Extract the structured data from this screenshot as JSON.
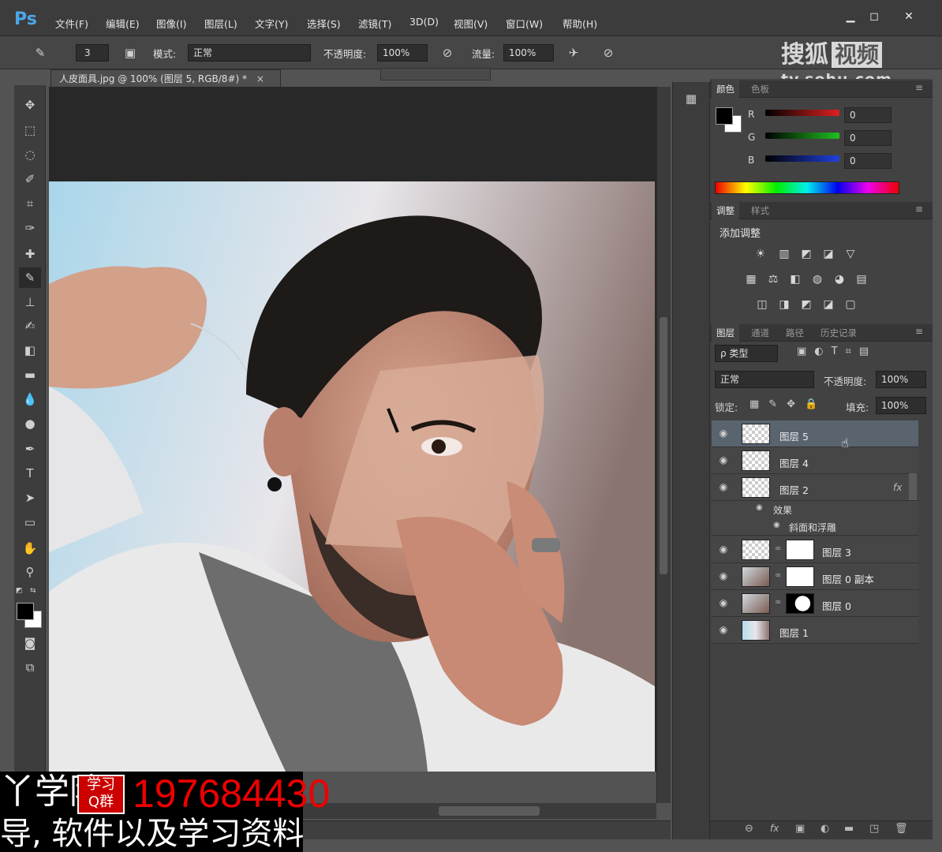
{
  "app": {
    "logo": "Ps"
  },
  "menu": [
    "文件(F)",
    "编辑(E)",
    "图像(I)",
    "图层(L)",
    "文字(Y)",
    "选择(S)",
    "滤镜(T)",
    "3D(D)",
    "视图(V)",
    "窗口(W)",
    "帮助(H)"
  ],
  "window_controls": [
    "▁",
    "◻",
    "✕"
  ],
  "options": {
    "brush_size": "3",
    "mode_label": "模式:",
    "mode_value": "正常",
    "opacity_label": "不透明度:",
    "opacity_value": "100%",
    "flow_label": "流量:",
    "flow_value": "100%"
  },
  "document": {
    "tab_title": "人皮面具.jpg @ 100% (图层 5, RGB/8#) *",
    "close": "×"
  },
  "color_panel": {
    "tabs": [
      "颜色",
      "色板"
    ],
    "channels": [
      {
        "label": "R",
        "value": "0",
        "color": "#e02020"
      },
      {
        "label": "G",
        "value": "0",
        "color": "#20c020"
      },
      {
        "label": "B",
        "value": "0",
        "color": "#2040e0"
      }
    ]
  },
  "adjustments_panel": {
    "tabs": [
      "调整",
      "样式"
    ],
    "heading": "添加调整",
    "row1": [
      "☀",
      "▥",
      "◩",
      "◪",
      "▽"
    ],
    "row2": [
      "▦",
      "⚖",
      "◧",
      "◍",
      "◕",
      "▤"
    ],
    "row3": [
      "◫",
      "◨",
      "◩",
      "◪",
      "▢"
    ]
  },
  "layers_panel": {
    "tabs": [
      "图层",
      "通道",
      "路径",
      "历史记录"
    ],
    "filter_label": "ρ 类型",
    "blend_mode": "正常",
    "opacity_label": "不透明度:",
    "opacity_value": "100%",
    "lock_label": "锁定:",
    "fill_label": "填充:",
    "fill_value": "100%",
    "layers": [
      {
        "name": "图层 5"
      },
      {
        "name": "图层 4"
      },
      {
        "name": "图层 2",
        "fx": "fx"
      },
      {
        "name": "图层 3"
      },
      {
        "name": "图层 0 副本"
      },
      {
        "name": "图层 0"
      },
      {
        "name": "图层 1"
      }
    ],
    "effects_label": "效果",
    "bevel_label": "斜面和浮雕"
  },
  "watermark": {
    "brand": "搜狐",
    "brand_box": "视频",
    "url": "tv.sohu.com"
  },
  "overlay": {
    "line1": "丫学院",
    "badge_top": "学习",
    "badge_bottom": "Q群",
    "qq": "197684430",
    "line2": "导, 软件以及学习资料"
  }
}
